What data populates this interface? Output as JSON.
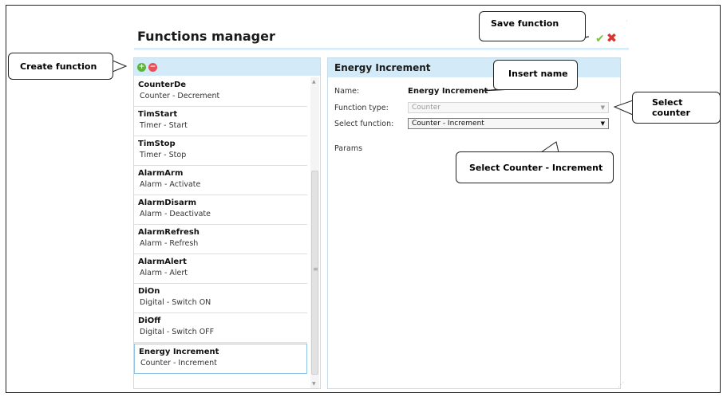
{
  "window": {
    "title": "Functions manager"
  },
  "toolbar": {
    "save_icon": "check-icon",
    "cancel_icon": "close-icon",
    "add_icon": "plus-icon",
    "remove_icon": "minus-icon"
  },
  "functions_list": [
    {
      "name": "CounterDe",
      "desc": "Counter - Decrement"
    },
    {
      "name": "TimStart",
      "desc": "Timer - Start"
    },
    {
      "name": "TimStop",
      "desc": "Timer - Stop"
    },
    {
      "name": "AlarmArm",
      "desc": "Alarm - Activate"
    },
    {
      "name": "AlarmDisarm",
      "desc": "Alarm - Deactivate"
    },
    {
      "name": "AlarmRefresh",
      "desc": "Alarm - Refresh"
    },
    {
      "name": "AlarmAlert",
      "desc": "Alarm - Alert"
    },
    {
      "name": "DiOn",
      "desc": "Digital - Switch ON"
    },
    {
      "name": "DiOff",
      "desc": "Digital - Switch OFF"
    },
    {
      "name": "Energy Increment",
      "desc": "Counter - Increment"
    }
  ],
  "detail": {
    "header": "Energy Increment",
    "name_label": "Name:",
    "name_value": "Energy Increment",
    "type_label": "Function type:",
    "type_value": "Counter",
    "select_label": "Select function:",
    "select_value": "Counter - Increment",
    "params_label": "Params"
  },
  "callouts": {
    "create": "Create function",
    "save": "Save function",
    "insert": "Insert name",
    "counter": "Select counter",
    "select_inc": "Select Counter - Increment"
  },
  "colors": {
    "accent": "#d3ebf8",
    "ok": "#7cc043",
    "cancel": "#e03030",
    "add": "#5db33c",
    "remove": "#e8505b"
  }
}
